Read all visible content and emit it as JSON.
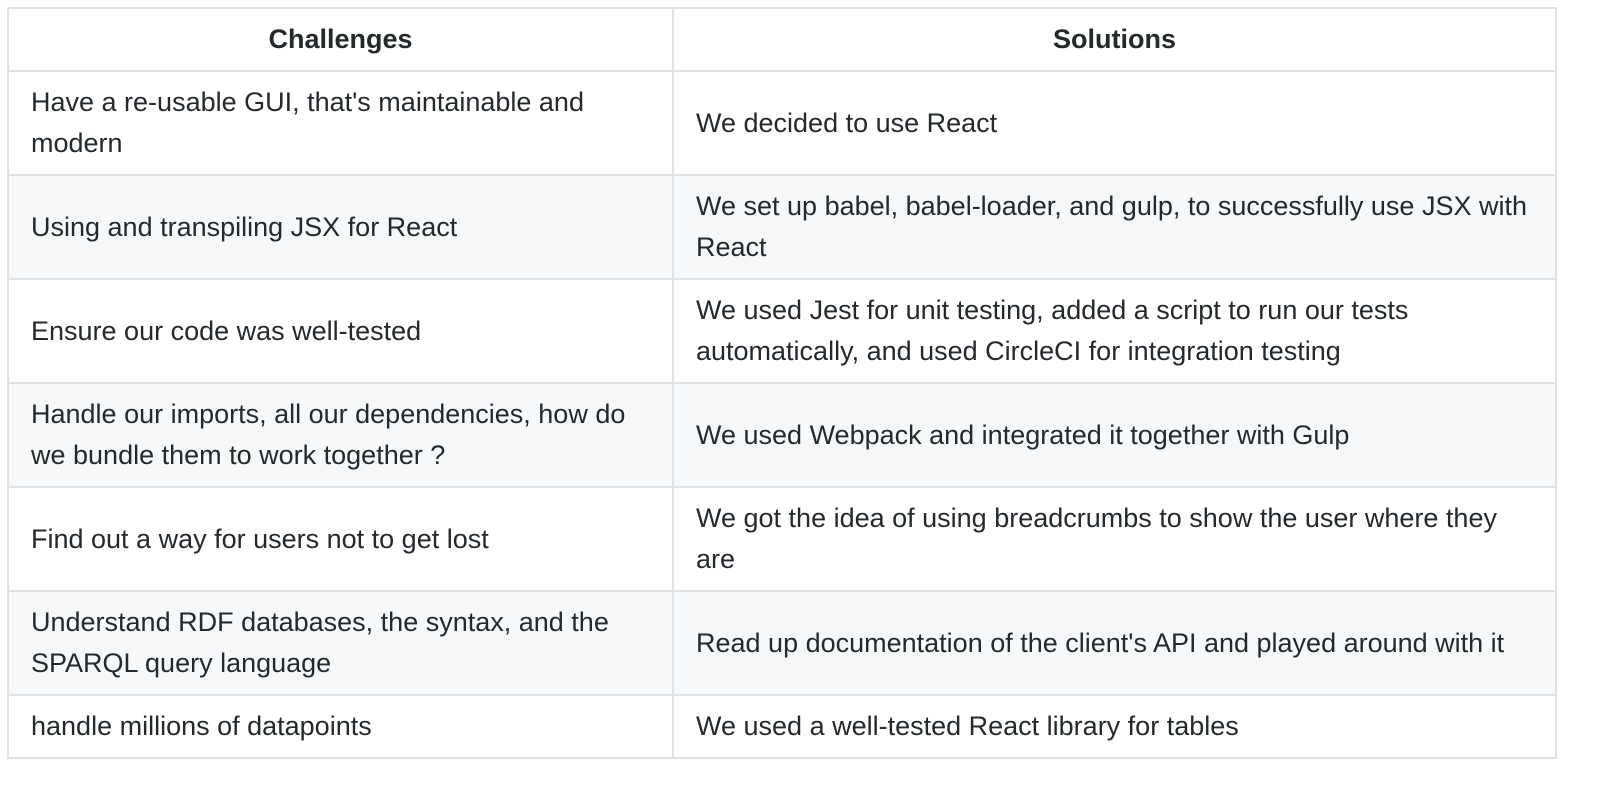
{
  "table": {
    "headers": {
      "challenges": "Challenges",
      "solutions": "Solutions"
    },
    "rows": [
      {
        "challenge": "Have a re-usable GUI, that's maintainable and modern",
        "solution": "We decided to use React"
      },
      {
        "challenge": "Using and transpiling JSX for React",
        "solution": "We set up babel, babel-loader, and gulp, to successfully use JSX with React"
      },
      {
        "challenge": "Ensure our code was well-tested",
        "solution": "We used Jest for unit testing, added a script to run our tests automatically, and used CircleCI for integration testing"
      },
      {
        "challenge": "Handle our imports, all our dependencies, how do we bundle them to work together ?",
        "solution": "We used Webpack and integrated it together with Gulp"
      },
      {
        "challenge": "Find out a way for users not to get lost",
        "solution": "We got the idea of using breadcrumbs to show the user where they are"
      },
      {
        "challenge": "Understand RDF databases, the syntax, and the SPARQL query language",
        "solution": "Read up documentation of the client's API and played around with it"
      },
      {
        "challenge": "handle millions of datapoints",
        "solution": "We used a well-tested React library for tables"
      }
    ]
  },
  "colors": {
    "text": "#24292e",
    "border": "#dfe2e5",
    "row_alt_background": "#f6f8fa",
    "background": "#ffffff"
  }
}
